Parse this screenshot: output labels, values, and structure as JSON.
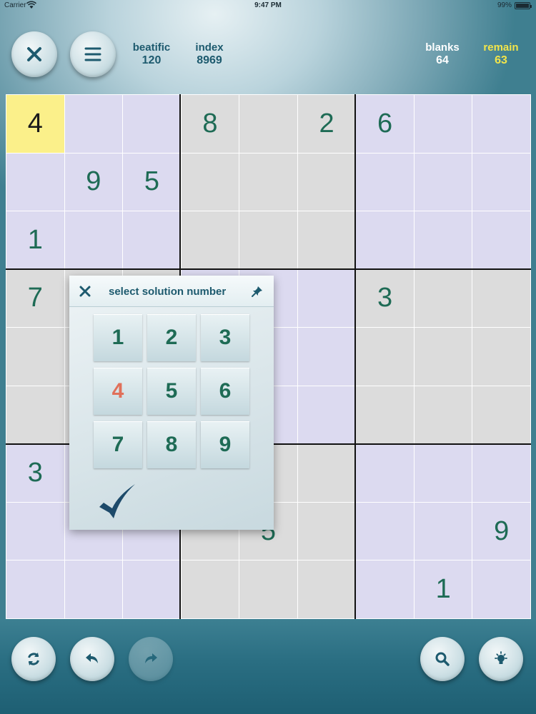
{
  "status_bar": {
    "carrier": "Carrier",
    "time": "9:47 PM",
    "battery": "99%"
  },
  "header": {
    "difficulty_label": "beatific",
    "difficulty_value": "120",
    "index_label": "index",
    "index_value": "8969",
    "blanks_label": "blanks",
    "blanks_value": "64",
    "remain_label": "remain",
    "remain_value": "63",
    "colors": {
      "stat_text": "#1d5a6e",
      "white_text": "#ffffff",
      "remain_text": "#f2e54a"
    }
  },
  "board": {
    "rows": [
      [
        "4",
        "",
        "",
        "8",
        "",
        "2",
        "6",
        "",
        ""
      ],
      [
        "",
        "9",
        "5",
        "",
        "",
        "",
        "",
        "",
        ""
      ],
      [
        "1",
        "",
        "",
        "",
        "",
        "",
        "",
        "",
        ""
      ],
      [
        "7",
        "",
        "",
        "",
        "",
        "",
        "3",
        "",
        ""
      ],
      [
        "",
        "",
        "",
        "",
        "",
        "",
        "",
        "",
        ""
      ],
      [
        "",
        "",
        "",
        "",
        "",
        "",
        "",
        "",
        ""
      ],
      [
        "3",
        "",
        "",
        "",
        "",
        "",
        "",
        "",
        ""
      ],
      [
        "",
        "",
        "",
        "",
        "5",
        "",
        "",
        "",
        "9"
      ],
      [
        "",
        "",
        "",
        "",
        "",
        "",
        "",
        "1",
        ""
      ]
    ],
    "selected_cell": [
      0,
      0
    ],
    "colors": {
      "given": "#1e6b55",
      "selected_bg": "#fbf08a",
      "lavender": "#dcdaf0",
      "gray": "#dcdcdc"
    }
  },
  "popup": {
    "title": "select solution number",
    "close_icon": "close-icon",
    "pin_icon": "pin-icon",
    "keys": [
      "1",
      "2",
      "3",
      "4",
      "5",
      "6",
      "7",
      "8",
      "9"
    ],
    "active_key": "4",
    "confirm_icon": "checkmark-icon"
  },
  "toolbar": {
    "left": [
      "refresh-icon",
      "undo-icon",
      "redo-icon"
    ],
    "right": [
      "search-icon",
      "lightbulb-icon"
    ]
  }
}
